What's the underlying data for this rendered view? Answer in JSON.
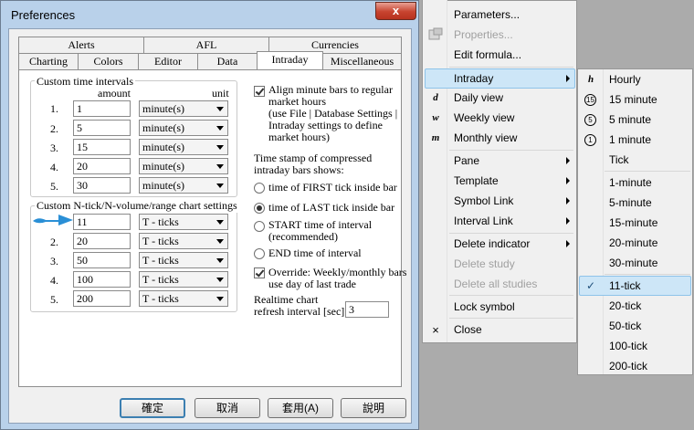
{
  "dialog": {
    "title": "Preferences",
    "close_glyph": "x",
    "tabs_row1": [
      "Alerts",
      "AFL",
      "Currencies"
    ],
    "tabs_row2": [
      "Charting",
      "Colors",
      "Editor",
      "Data",
      "Intraday",
      "Miscellaneous"
    ],
    "selected_tab": "Intraday"
  },
  "custom_intervals": {
    "label": "Custom time intervals",
    "col_amount": "amount",
    "col_unit": "unit",
    "rows": [
      {
        "num": "1.",
        "amount": "1",
        "unit": "minute(s)"
      },
      {
        "num": "2.",
        "amount": "5",
        "unit": "minute(s)"
      },
      {
        "num": "3.",
        "amount": "15",
        "unit": "minute(s)"
      },
      {
        "num": "4.",
        "amount": "20",
        "unit": "minute(s)"
      },
      {
        "num": "5.",
        "amount": "30",
        "unit": "minute(s)"
      }
    ]
  },
  "nticks": {
    "label": "Custom N-tick/N-volume/range chart settings",
    "rows": [
      {
        "num": "",
        "amount": "11",
        "unit": "T - ticks"
      },
      {
        "num": "2.",
        "amount": "20",
        "unit": "T - ticks"
      },
      {
        "num": "3.",
        "amount": "50",
        "unit": "T - ticks"
      },
      {
        "num": "4.",
        "amount": "100",
        "unit": "T - ticks"
      },
      {
        "num": "5.",
        "amount": "200",
        "unit": "T - ticks"
      }
    ]
  },
  "right": {
    "align_check": "Align minute bars to regular market hours",
    "align_check_l1": "Align minute bars to regular",
    "align_check_l2": "market hours",
    "align_note_l1": "(use File | Database Settings |",
    "align_note_l2": "Intraday settings to define",
    "align_note_l3": "market hours)",
    "timestamp_l1": "Time stamp of compressed",
    "timestamp_l2": "intraday bars shows:",
    "radio1": "time of FIRST tick inside bar",
    "radio2": "time of LAST tick inside bar",
    "radio3_l1": "START time of interval",
    "radio3_l2": "(recommended)",
    "radio4": "END time of interval",
    "override_l1": "Override: Weekly/monthly bars",
    "override_l2": "use day of last trade",
    "refresh_l1": "Realtime chart",
    "refresh_l2": "refresh interval [sec]",
    "refresh_value": "3"
  },
  "buttons": {
    "ok": "確定",
    "cancel": "取消",
    "apply": "套用(A)",
    "help": "說明"
  },
  "context_menu": {
    "items": [
      {
        "label": "Parameters...",
        "disabled": false
      },
      {
        "label": "Properties...",
        "disabled": true
      },
      {
        "label": "Edit formula...",
        "disabled": false
      },
      {
        "label": "Intraday",
        "disabled": false
      },
      {
        "label": "Daily view",
        "disabled": false,
        "icon": "d"
      },
      {
        "label": "Weekly view",
        "disabled": false,
        "icon": "w"
      },
      {
        "label": "Monthly view",
        "disabled": false,
        "icon": "m"
      },
      {
        "label": "Pane",
        "disabled": false
      },
      {
        "label": "Template",
        "disabled": false
      },
      {
        "label": "Symbol Link",
        "disabled": false
      },
      {
        "label": "Interval Link",
        "disabled": false
      },
      {
        "label": "Delete indicator",
        "disabled": false
      },
      {
        "label": "Delete study",
        "disabled": true
      },
      {
        "label": "Delete all studies",
        "disabled": true
      },
      {
        "label": "Lock symbol",
        "disabled": false
      },
      {
        "label": "Close",
        "disabled": false,
        "icon": "×"
      }
    ]
  },
  "submenu": {
    "items": [
      {
        "label": "Hourly",
        "icon": "h"
      },
      {
        "label": "15 minute",
        "icon": "15"
      },
      {
        "label": "5 minute",
        "icon": "5"
      },
      {
        "label": "1 minute",
        "icon": "1"
      },
      {
        "label": "Tick",
        "icon": ""
      },
      {
        "label": "1-minute"
      },
      {
        "label": "5-minute"
      },
      {
        "label": "15-minute"
      },
      {
        "label": "20-minute"
      },
      {
        "label": "30-minute"
      },
      {
        "label": "11-tick",
        "checked": true
      },
      {
        "label": "20-tick"
      },
      {
        "label": "50-tick"
      },
      {
        "label": "100-tick"
      },
      {
        "label": "200-tick"
      }
    ],
    "check_glyph": "✓"
  },
  "colors": {
    "highlight": "#cde6f7",
    "arrow": "#2a8fd6",
    "titlebar": "#b9d1ea",
    "close": "#c7432f"
  }
}
